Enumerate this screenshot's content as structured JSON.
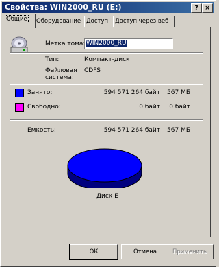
{
  "window": {
    "title": "Свойства: WIN2000_RU (E:)",
    "help_label": "?",
    "close_label": "×"
  },
  "tabs": [
    {
      "label": "Общие",
      "active": true
    },
    {
      "label": "Оборудование",
      "active": false
    },
    {
      "label": "Доступ",
      "active": false
    },
    {
      "label": "Доступ через веб",
      "active": false
    }
  ],
  "general": {
    "label_caption": "Метка тома:",
    "label_value": "WIN2000_RU",
    "type_caption": "Тип:",
    "type_value": "Компакт-диск",
    "fs_caption": "Файловая система:",
    "fs_value": "CDFS"
  },
  "usage": {
    "used": {
      "label": "Занято:",
      "bytes": "594 571 264 байт",
      "size": "567 МБ",
      "color": "#0000ff"
    },
    "free": {
      "label": "Свободно:",
      "bytes": "0 байт",
      "size": "0 байт",
      "color": "#ff00ff"
    },
    "capacity": {
      "label": "Емкость:",
      "bytes": "594 571 264 байт",
      "size": "567 МБ"
    },
    "used_fraction": 1.0
  },
  "pie": {
    "caption": "Диск E"
  },
  "buttons": {
    "ok": "ОК",
    "cancel": "Отмена",
    "apply": "Применить"
  },
  "icons": {
    "drive": "cd-drive-icon"
  }
}
